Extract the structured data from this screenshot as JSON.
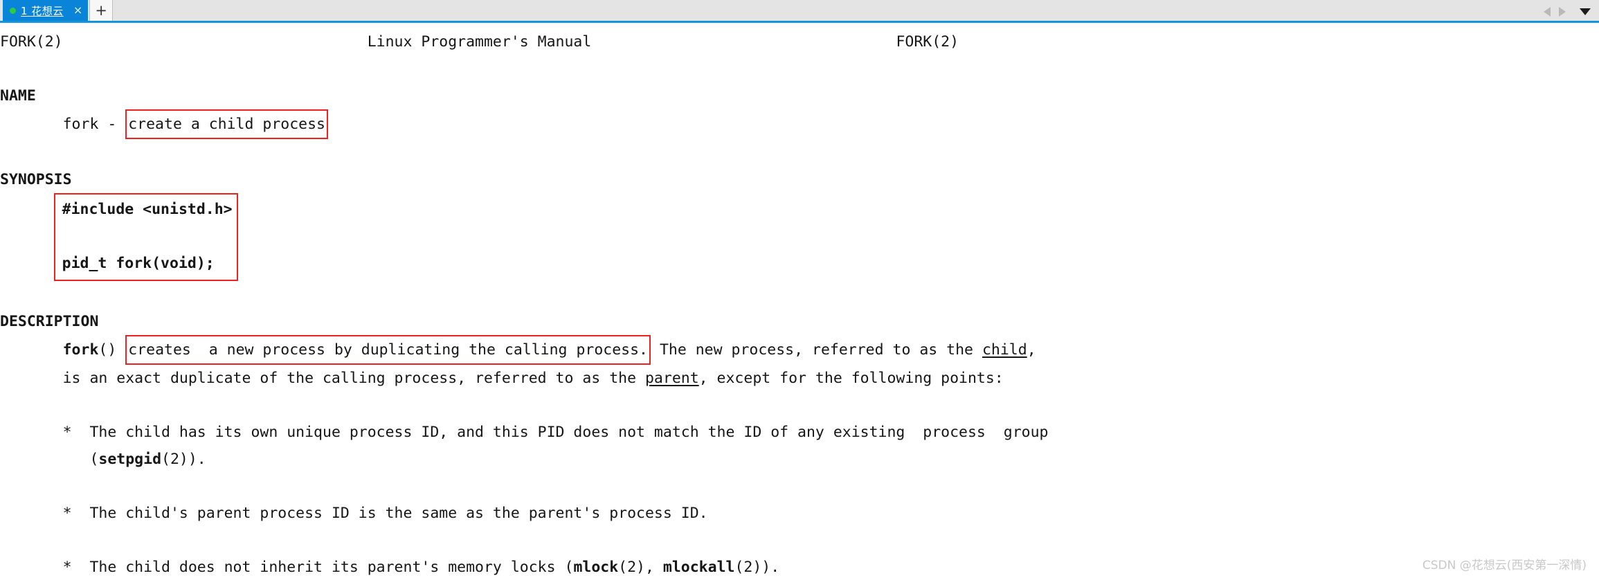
{
  "tabbar": {
    "tab": {
      "title": "1 花想云",
      "close_label": "×",
      "status_dot_color": "#2ecc40",
      "active_color": "#0a84d8"
    },
    "new_tab_label": "+",
    "nav_prev_icon": "triangle-left-icon",
    "nav_next_icon": "triangle-right-icon",
    "tab_list_icon": "triangle-down-icon"
  },
  "man": {
    "header": {
      "left": "FORK(2)",
      "center": "Linux Programmer's Manual",
      "right": "FORK(2)"
    },
    "sections": {
      "name": {
        "heading": "NAME",
        "cmd": "fork - ",
        "boxed_text": "create a child process"
      },
      "synopsis": {
        "heading": "SYNOPSIS",
        "line1": "#include <unistd.h>",
        "line2": "pid_t fork(void);"
      },
      "description": {
        "heading": "DESCRIPTION",
        "func": "fork",
        "func_parens": "()",
        "boxed_text": "creates  a new process by duplicating the calling process.",
        "after_box_1": "The new process, referred to as the ",
        "child_term": "child",
        "after_box_2": ",",
        "line2_a": "is an exact duplicate of the calling process, referred to as the ",
        "parent_term": "parent",
        "line2_b": ", except for the following points:",
        "bullets": [
          {
            "marker": "*",
            "line1": "The child has its own unique process ID, and this PID does not match the ID of any existing  process  group",
            "line2_pre": "(",
            "line2_bold": "setpgid",
            "line2_post": "(2))."
          },
          {
            "marker": "*",
            "line1": "The child's parent process ID is the same as the parent's process ID."
          },
          {
            "marker": "*",
            "line1_a": "The child does not inherit its parent's memory locks (",
            "bold1": "mlock",
            "line1_b": "(2), ",
            "bold2": "mlockall",
            "line1_c": "(2))."
          }
        ]
      }
    }
  },
  "watermark": "CSDN @花想云(西安第一深情)",
  "colors": {
    "annotation_red": "#ee2222",
    "tab_blue": "#0a84d8",
    "accent_underline": "#1296db"
  }
}
